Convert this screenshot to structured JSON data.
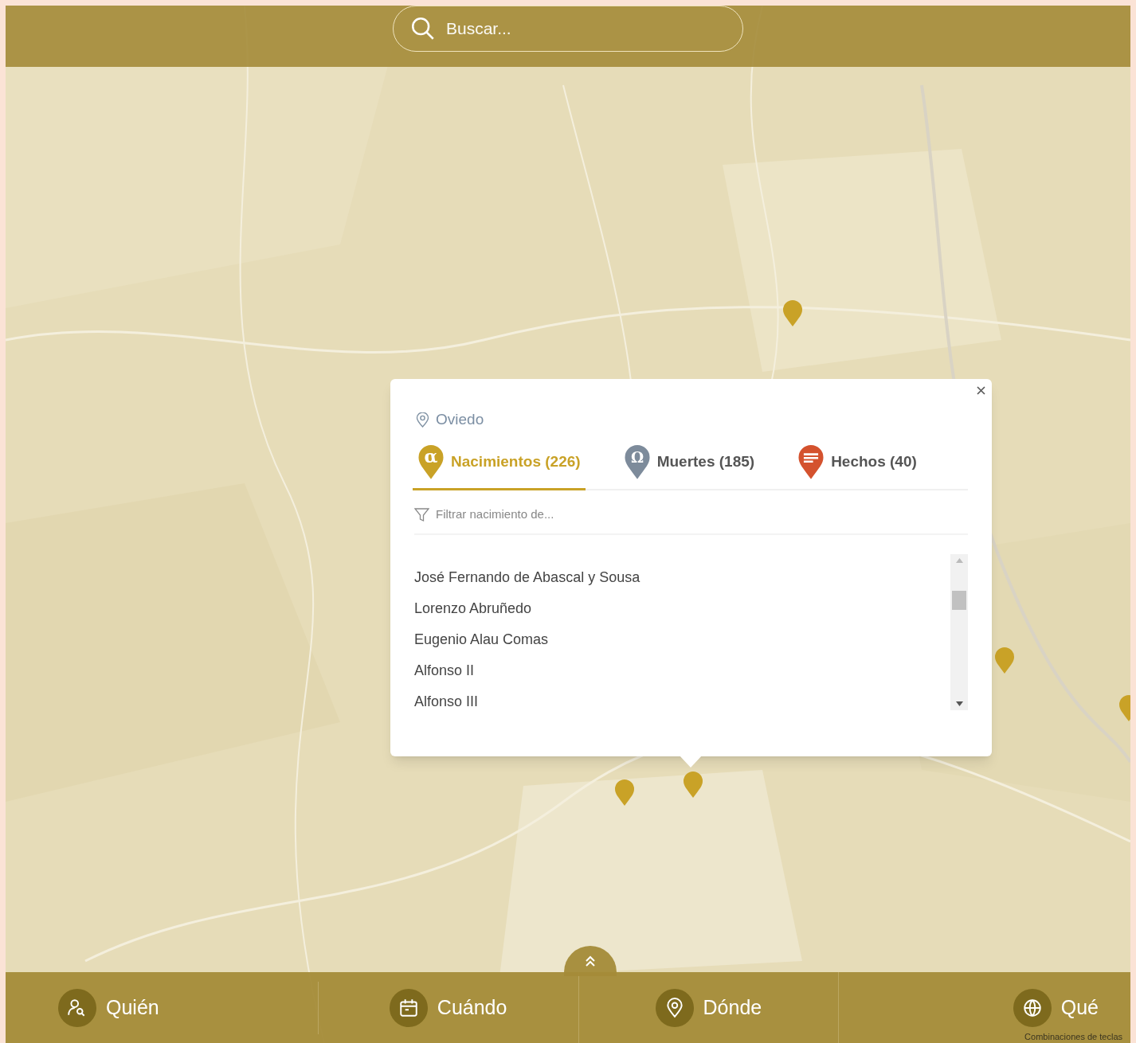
{
  "search": {
    "placeholder": "Buscar..."
  },
  "popup": {
    "location": "Oviedo",
    "tabs": [
      {
        "label": "Nacimientos (226)",
        "selected": true,
        "kind": "alpha",
        "glyph": "α",
        "color": "#c9a227"
      },
      {
        "label": "Muertes (185)",
        "selected": false,
        "kind": "omega",
        "glyph": "Ω",
        "color": "#7d8b9b"
      },
      {
        "label": "Hechos (40)",
        "selected": false,
        "kind": "lines",
        "color": "#d4522e"
      }
    ],
    "filter": {
      "placeholder": "Filtrar nacimiento de..."
    },
    "items": [
      "José Fernando de Abascal y Sousa",
      "Lorenzo Abruñedo",
      "Eugenio Alau Comas",
      "Alfonso II",
      "Alfonso III"
    ]
  },
  "bottom_nav": [
    {
      "label": "Quién",
      "kind": "person"
    },
    {
      "label": "Cuándo",
      "kind": "calendar"
    },
    {
      "label": "Dónde",
      "kind": "pin"
    },
    {
      "label": "Qué",
      "kind": "globe"
    }
  ],
  "attribution": "Combinaciones de teclas"
}
